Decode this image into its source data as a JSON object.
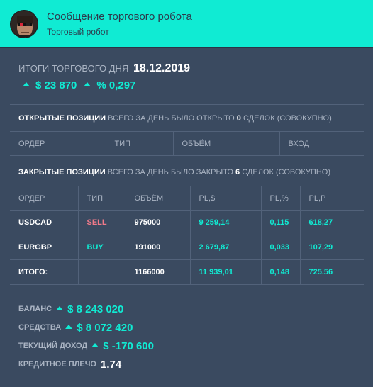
{
  "header": {
    "title": "Сообщение торгового робота",
    "subtitle": "Торговый робот"
  },
  "summary": {
    "label": "ИТОГИ ТОРГОВОГО ДНЯ",
    "date": "18.12.2019",
    "profit": "$ 23 870",
    "percent": "% 0,297"
  },
  "open_positions": {
    "title": "ОТКРЫТЫЕ ПОЗИЦИИ",
    "text_before": " ВСЕГО ЗА ДЕНЬ БЫЛО ОТКРЫТО ",
    "count": "0",
    "text_after": " СДЕЛОК (СОВОКУПНО)",
    "columns": [
      "ОРДЕР",
      "ТИП",
      "ОБЪЁМ",
      "ВХОД"
    ]
  },
  "closed_positions": {
    "title": "ЗАКРЫТЫЕ ПОЗИЦИИ",
    "text_before": " ВСЕГО ЗА ДЕНЬ БЫЛО ЗАКРЫТО ",
    "count": "6",
    "text_after": " СДЕЛОК (СОВОКУПНО)",
    "columns": [
      "ОРДЕР",
      "ТИП",
      "ОБЪЁМ",
      "PL,$",
      "PL,%",
      "PL,P"
    ],
    "rows": [
      [
        "USDCAD",
        "SELL",
        "975000",
        "9 259,14",
        "0,115",
        "618,27"
      ],
      [
        "EURGBP",
        "BUY",
        "191000",
        "2 679,87",
        "0,033",
        "107,29"
      ]
    ],
    "total": [
      "ИТОГО:",
      "",
      "1166000",
      "11 939,01",
      "0,148",
      "725.56"
    ]
  },
  "stats": {
    "balance_label": "БАЛАНС",
    "balance_value": "$ 8 243 020",
    "equity_label": "СРЕДСТВА",
    "equity_value": "$ 8 072 420",
    "income_label": "ТЕКУЩИЙ ДОХОД",
    "income_value": "$ -170 600",
    "leverage_label": "КРЕДИТНОЕ ПЛЕЧО",
    "leverage_value": "1.74"
  },
  "colors": {
    "accent": "#10ebd3",
    "background": "#3a4a60",
    "sell": "#f07a8a",
    "buy": "#10ebd3"
  }
}
